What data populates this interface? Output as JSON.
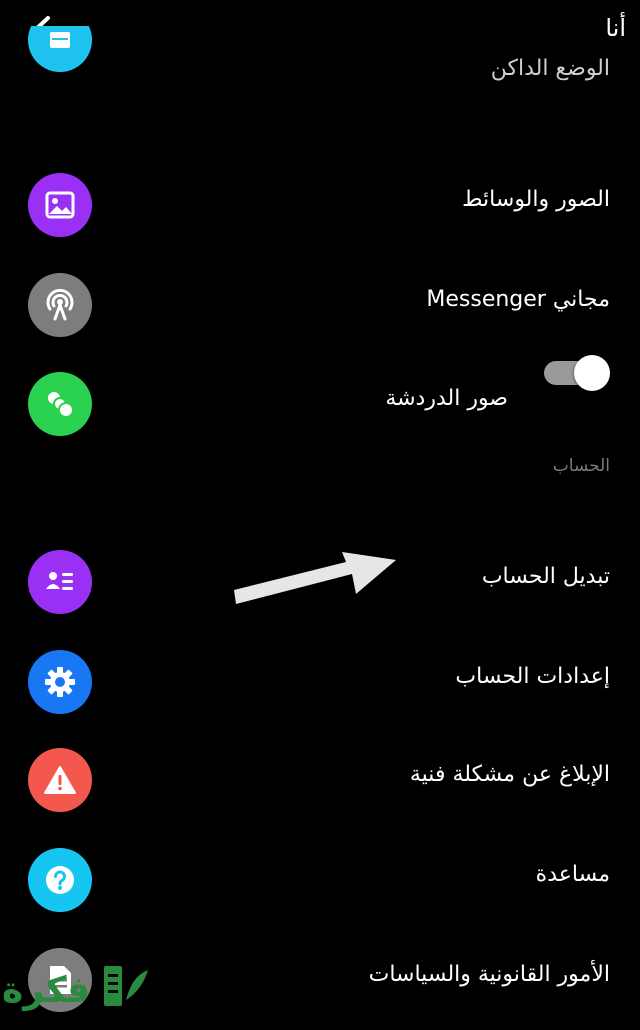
{
  "header": {
    "title": "أنا",
    "back_icon": "arrow-left-icon"
  },
  "menu": {
    "partial_label": "الوضع الداكن",
    "media_label": "الصور والوسائط",
    "free_label": "مجاني Messenger",
    "chat_heads_label": "صور الدردشة",
    "chat_heads_toggle_on": true
  },
  "account": {
    "section_label": "الحساب",
    "switch_account": "تبديل الحساب",
    "account_settings": "إعدادات الحساب",
    "report_problem": "الإبلاغ عن مشكلة فنية",
    "help": "مساعدة",
    "legal": "الأمور القانونية والسياسات"
  },
  "watermark": {
    "text": "فكرة"
  },
  "colors": {
    "cyan": "#1ec3f0",
    "purple": "#9b30f5",
    "gray": "#7d7d7d",
    "green": "#2bd24f",
    "blue": "#1877f2",
    "red": "#f4574d",
    "help_cyan": "#17c5f3",
    "watermark_green": "#2a8a3e"
  }
}
